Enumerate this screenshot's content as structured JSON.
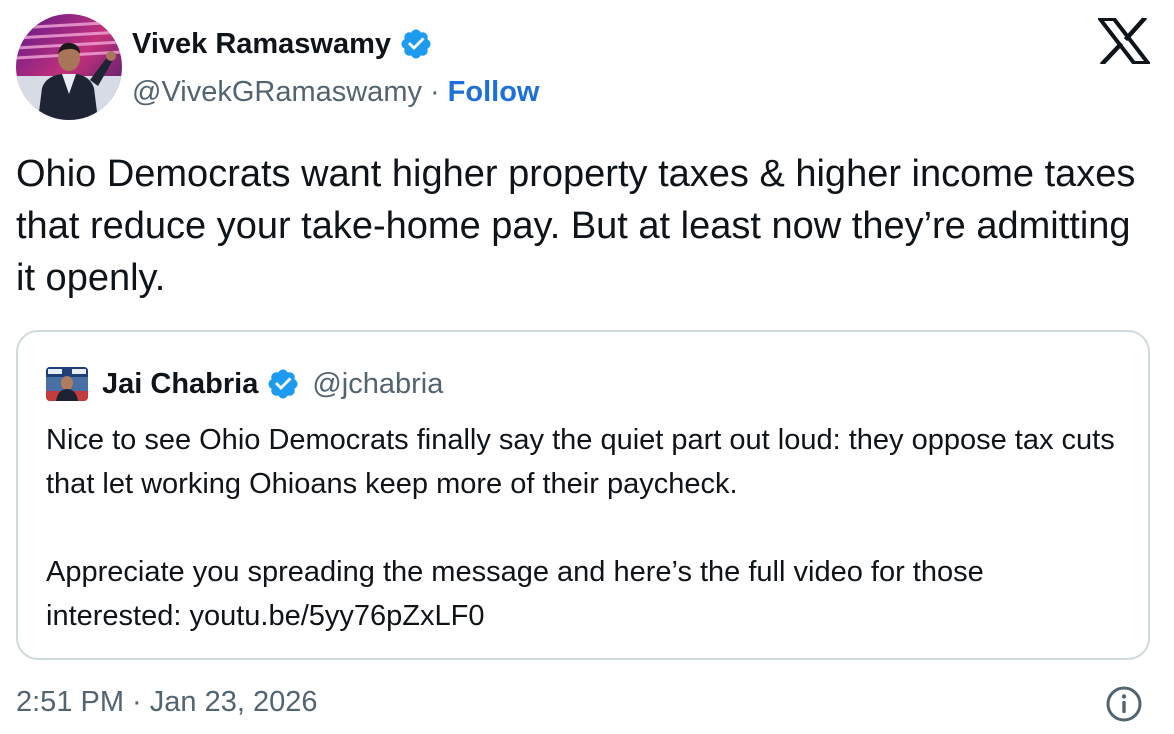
{
  "author": {
    "display_name": "Vivek Ramaswamy",
    "handle": "@VivekGRamaswamy",
    "separator": "·",
    "follow_label": "Follow"
  },
  "tweet": {
    "text": "Ohio Democrats want higher property taxes & higher income taxes that reduce your take-home pay. But at least now they’re admitting it openly."
  },
  "quoted_tweet": {
    "display_name": "Jai Chabria",
    "handle": "@jchabria",
    "paragraph_1": "Nice to see Ohio Democrats finally say the quiet part out loud: they oppose tax cuts that let working Ohioans keep more of their paycheck.",
    "paragraph_2": "Appreciate you spreading the message and here’s the full video for those interested: youtu.be/5yy76pZxLF0"
  },
  "footer": {
    "timestamp": "2:51 PM · Jan 23, 2026"
  },
  "icons": {
    "logo": "x-logo-icon",
    "verified": "verified-badge-icon",
    "info": "info-icon"
  },
  "colors": {
    "text": "#0f1419",
    "secondary_text": "#536471",
    "follow_link": "#1d6fd9",
    "verified_badge": "#1d9bf0",
    "card_border": "#cfd9de"
  }
}
